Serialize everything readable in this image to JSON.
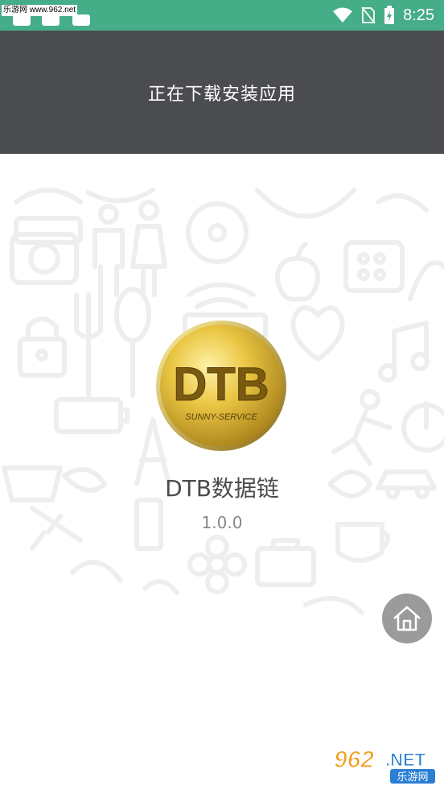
{
  "status_bar": {
    "watermark": "乐游网 www.962.net",
    "time": "8:25",
    "background": "#45ad87",
    "icons": [
      "wifi-icon",
      "no-sim-icon",
      "battery-charging-icon"
    ]
  },
  "header": {
    "title": "正在下载安装应用",
    "background": "#4a4c50"
  },
  "app": {
    "logo_text": "DTB",
    "logo_subtext": "SUNNY-SERVICE",
    "name": "DTB数据链",
    "version": "1.0.0"
  },
  "home_button": {
    "icon": "home-icon"
  },
  "watermark_br": {
    "brand": "962",
    "suffix": ".NET",
    "caption": "乐游网"
  }
}
